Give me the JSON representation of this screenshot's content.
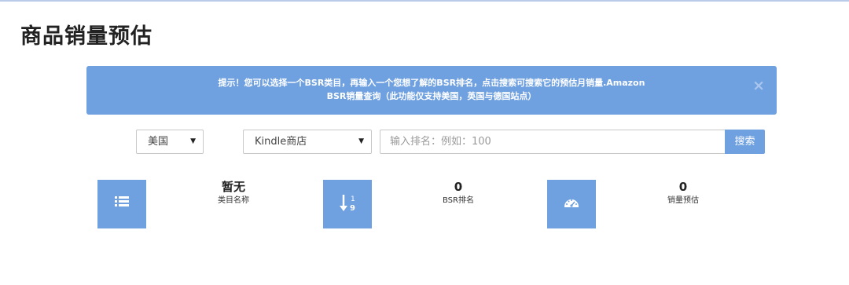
{
  "page": {
    "title": "商品销量预估"
  },
  "alert": {
    "line1": "提示！您可以选择一个BSR类目，再输入一个您想了解的BSR排名，点击搜索可搜索它的预估月销量.Amazon",
    "line2": "BSR销量查询（此功能仅支持美国，英国与德国站点）",
    "close_symbol": "×",
    "background": "#6fa0e0"
  },
  "filters": {
    "country": "美国",
    "category": "Kindle商店",
    "caret": "▼",
    "search_placeholder": "输入排名：例如：100",
    "search_button": "搜索"
  },
  "stats": [
    {
      "icon": "list-icon",
      "value": "暂无",
      "label": "类目名称"
    },
    {
      "icon": "sort-numeric-icon",
      "value": "0",
      "label": "BSR排名"
    },
    {
      "icon": "dashboard-icon",
      "value": "0",
      "label": "销量预估"
    }
  ],
  "colors": {
    "accent": "#6fa0e0"
  }
}
